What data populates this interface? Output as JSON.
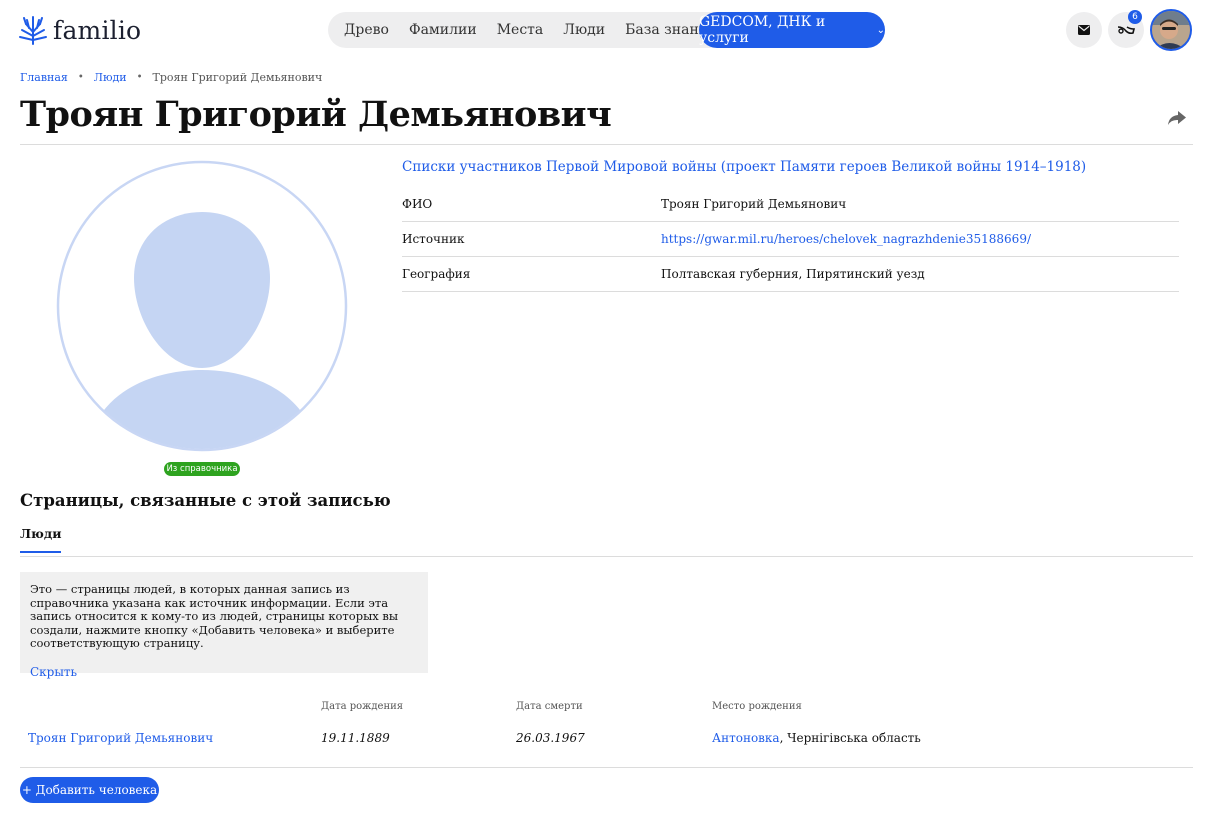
{
  "header": {
    "logo_text": "familio",
    "nav": [
      "Древо",
      "Фамилии",
      "Места",
      "Люди",
      "База знаний"
    ],
    "services_label": "GEDCOM, ДНК и услуги",
    "notifications_count": "6",
    "accent_color": "#1f5ce8"
  },
  "breadcrumb": {
    "home": "Главная",
    "people": "Люди",
    "current": "Троян Григорий Демьянович"
  },
  "page_title": "Троян Григорий Демьянович",
  "portrait": {
    "badge": "Из справочника"
  },
  "record": {
    "source_title": "Списки участников Первой Мировой войны (проект Памяти героев Великой войны 1914–1918)",
    "rows": [
      {
        "key": "ФИО",
        "value": "Троян Григорий Демьянович"
      },
      {
        "key": "Источник",
        "value": "https://gwar.mil.ru/heroes/chelovek_nagrazhdenie35188669/"
      },
      {
        "key": "География",
        "value": "Полтавская губерния, Пирятинский уезд"
      }
    ]
  },
  "related": {
    "title": "Страницы, связанные с этой записью",
    "tab": "Люди",
    "info_text": "Это — страницы людей, в которых данная запись из справочника указана как источник информации. Если эта запись относится к кому-то из людей, страницы которых вы создали, нажмите кнопку «Добавить человека» и выберите соответствующую страницу.",
    "hide_label": "Скрыть",
    "columns": {
      "birth_date": "Дата рождения",
      "death_date": "Дата смерти",
      "birth_place": "Место рождения"
    },
    "people": [
      {
        "name": "Троян Григорий Демьянович",
        "birth_date": "19.11.1889",
        "death_date": "26.03.1967",
        "birth_place_link": "Антоновка",
        "birth_place_rest": ", Чернігівська область"
      }
    ],
    "add_button": "+ Добавить человека"
  }
}
